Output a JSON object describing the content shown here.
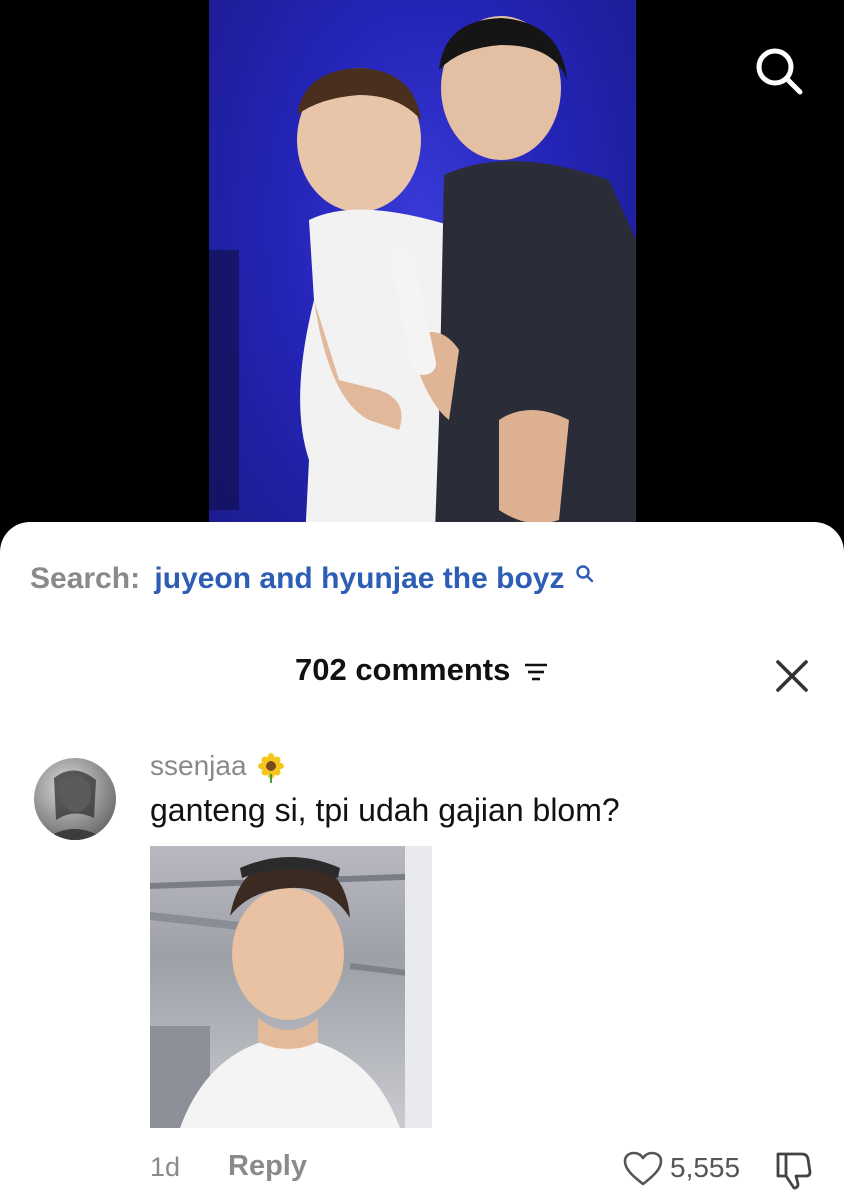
{
  "header": {
    "search_icon": "search-icon"
  },
  "sheet": {
    "search_prefix": "Search:",
    "search_query": "juyeon and hyunjae the boyz",
    "comments_count_label": "702 comments",
    "close_icon": "close-icon"
  },
  "comment": {
    "username": "ssenjaa",
    "username_emoji": "sunflower",
    "text": "ganteng si, tpi udah gajian blom?",
    "time": "1d",
    "reply_label": "Reply",
    "likes": "5,555"
  },
  "colors": {
    "query_blue": "#2d5db5",
    "muted_gray": "#8a8a8a",
    "video_bg": "#2424b8"
  }
}
